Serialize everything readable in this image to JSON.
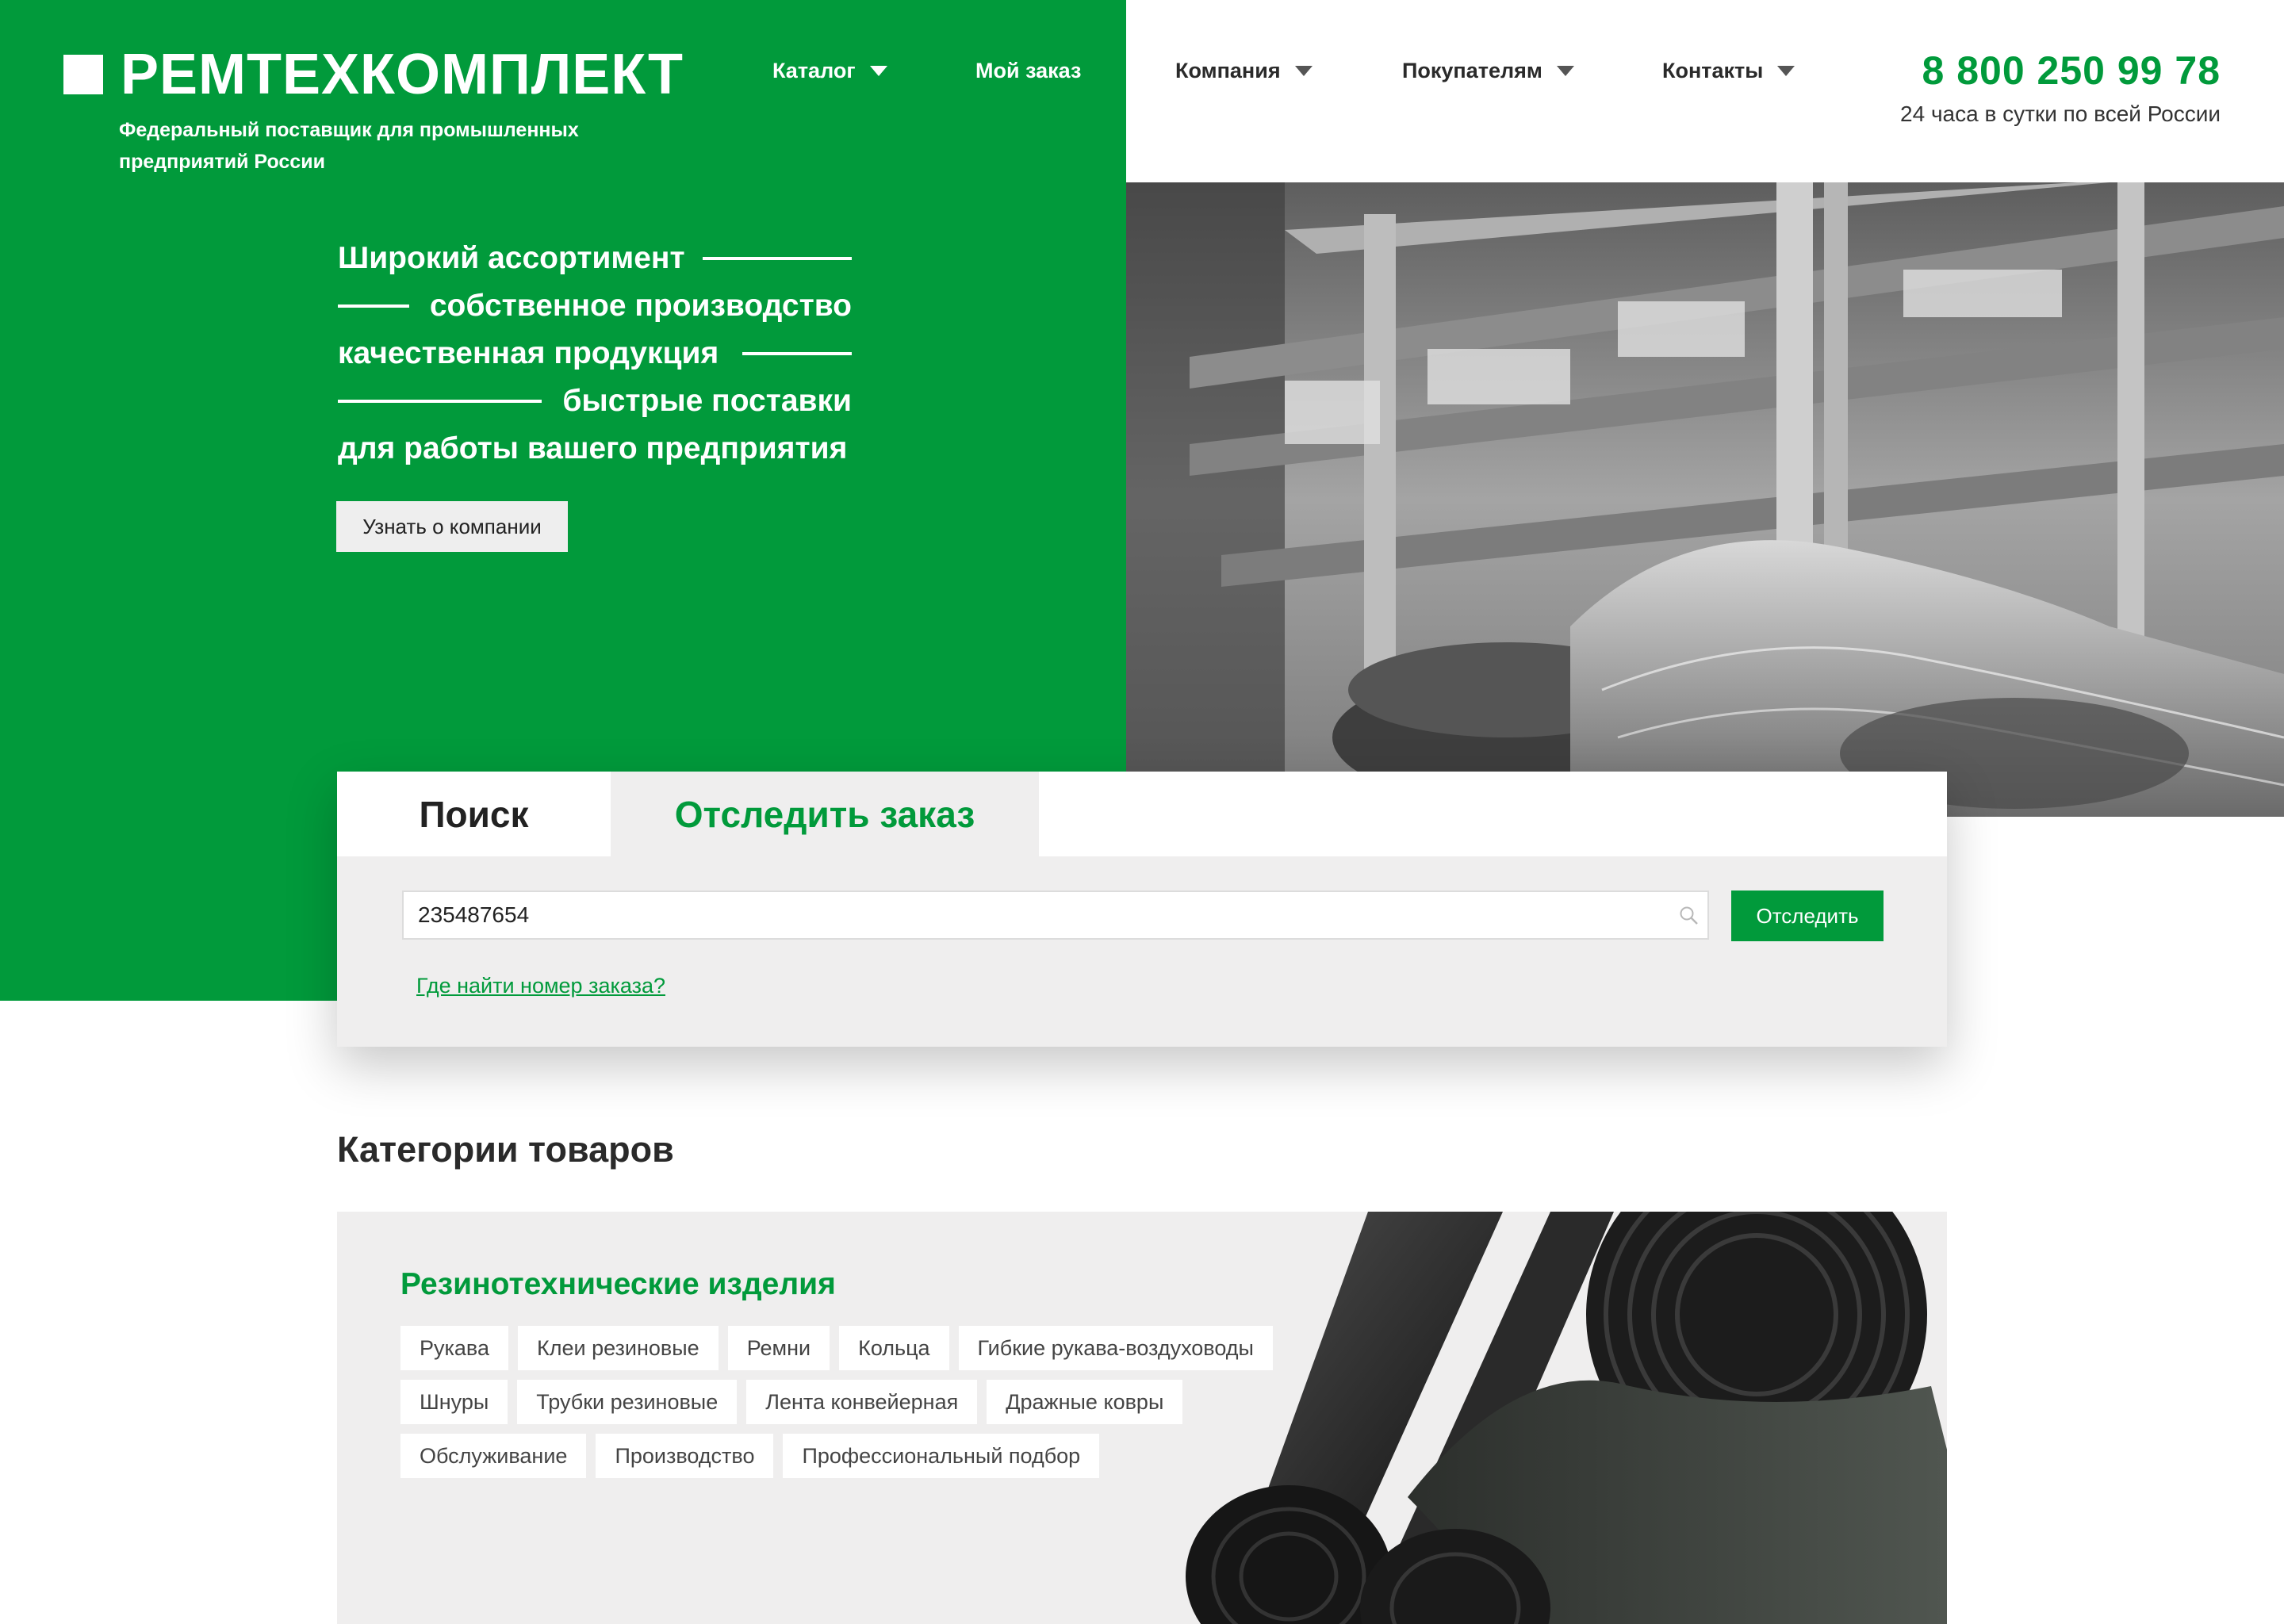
{
  "header": {
    "logo_text": "РЕМТЕХКОМПЛЕКТ",
    "tagline": "Федеральный поставщик для промышленных предприятий России",
    "phone": "8 800 250 99 78",
    "phone_note": "24 часа в сутки по всей России"
  },
  "nav": {
    "catalog": "Каталог",
    "my_order": "Мой заказ",
    "company": "Компания",
    "buyers": "Покупателям",
    "contacts": "Контакты"
  },
  "hero": {
    "lines": [
      "Широкий ассортимент",
      "собственное производство",
      "качественная продукция",
      "быстрые поставки",
      "для работы вашего предприятия"
    ],
    "about_button": "Узнать о компании"
  },
  "order_panel": {
    "tabs": [
      "Поиск",
      "Отследить заказ"
    ],
    "active_tab": "Отследить заказ",
    "input_value": "235487654",
    "track_button": "Отследить",
    "help_link": "Где найти номер заказа?"
  },
  "categories": {
    "title": "Категории товаров",
    "card_title": "Резинотехнические изделия",
    "chips": [
      "Рукава",
      "Клеи резиновые",
      "Ремни",
      "Кольца",
      "Гибкие рукава-воздуховоды",
      "Шнуры",
      "Трубки резиновые",
      "Лента конвейерная",
      "Дражные ковры",
      "Обслуживание",
      "Производство",
      "Профессиональный подбор"
    ]
  },
  "colors": {
    "brand_green": "#019a3b",
    "panel_gray": "#efeeee"
  }
}
